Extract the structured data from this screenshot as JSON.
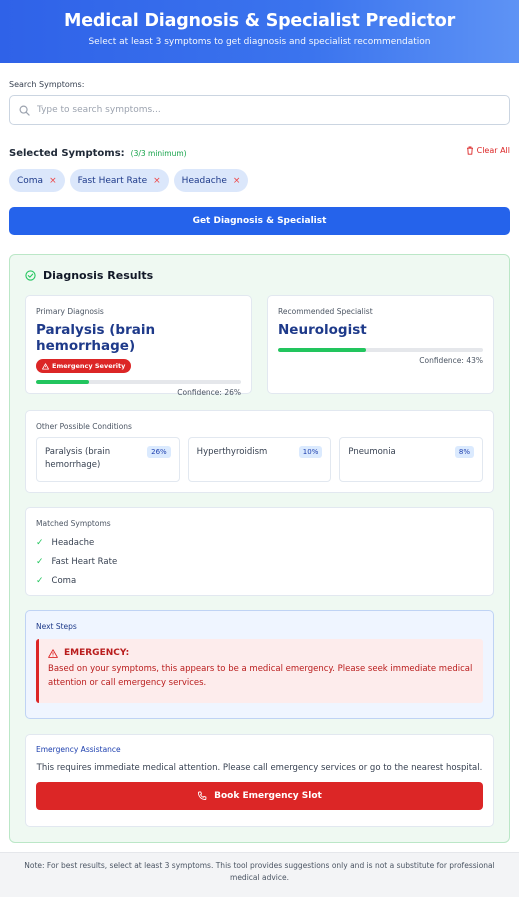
{
  "header": {
    "title": "Medical Diagnosis & Specialist Predictor",
    "subtitle": "Select at least 3 symptoms to get diagnosis and specialist recommendation"
  },
  "search": {
    "label": "Search Symptoms:",
    "placeholder": "Type to search symptoms...",
    "icon": "search-icon"
  },
  "selected": {
    "title": "Selected Symptoms:",
    "count": "(3/3 minimum)",
    "clear_label": "Clear All",
    "chips": [
      "Coma",
      "Fast Heart Rate",
      "Headache"
    ],
    "remove_glyph": "×"
  },
  "diagnose_button": "Get Diagnosis & Specialist",
  "results": {
    "title": "Diagnosis Results",
    "primary": {
      "label": "Primary Diagnosis",
      "name": "Paralysis (brain hemorrhage)",
      "severity": "Emergency Severity",
      "confidence_text": "Confidence: 26%",
      "confidence": 0.26
    },
    "specialist": {
      "label": "Recommended Specialist",
      "name": "Neurologist",
      "confidence_text": "Confidence: 43%",
      "confidence": 0.43
    },
    "other": {
      "label": "Other Possible Conditions",
      "items": [
        {
          "name": "Paralysis (brain hemorrhage)",
          "pct": "26%"
        },
        {
          "name": "Hyperthyroidism",
          "pct": "10%"
        },
        {
          "name": "Pneumonia",
          "pct": "8%"
        }
      ]
    },
    "matched": {
      "label": "Matched Symptoms",
      "items": [
        "Headache",
        "Fast Heart Rate",
        "Coma"
      ]
    },
    "next_steps": {
      "label": "Next Steps",
      "emergency_title": "EMERGENCY:",
      "emergency_text": "Based on your symptoms, this appears to be a medical emergency. Please seek immediate medical attention or call emergency services."
    },
    "assistance": {
      "label": "Emergency Assistance",
      "text": "This requires immediate medical attention. Please call emergency services or go to the nearest hospital.",
      "button": "Book Emergency Slot"
    }
  },
  "footer": "Note: For best results, select at least 3 symptoms. This tool provides suggestions only and is not a substitute for professional medical advice.",
  "colors": {
    "primary": "#2563eb",
    "danger": "#dc2626",
    "success": "#22c55e"
  }
}
